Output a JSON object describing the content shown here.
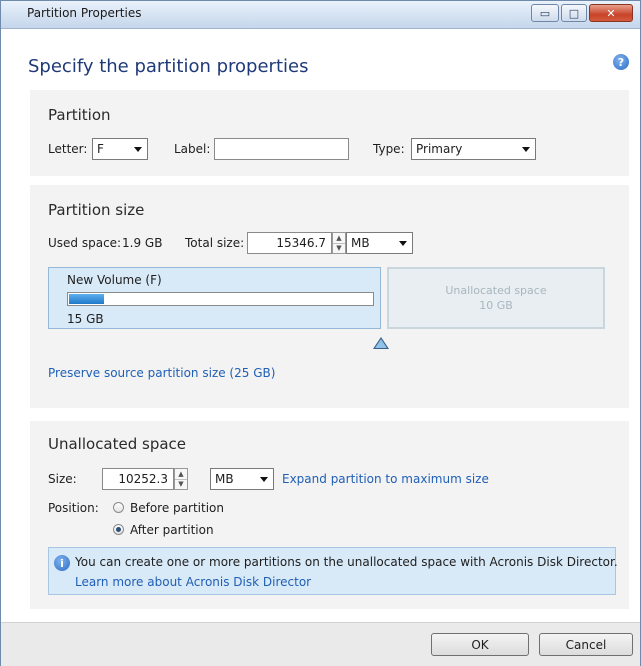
{
  "window": {
    "title": "Partition Properties",
    "minimize_glyph": "▭",
    "maximize_glyph": "□",
    "close_glyph": "✕"
  },
  "heading": "Specify the partition properties",
  "help_icon": "?",
  "partition": {
    "title": "Partition",
    "letter_label": "Letter:",
    "letter_value": "F",
    "label_label": "Label:",
    "label_value": "",
    "type_label": "Type:",
    "type_value": "Primary"
  },
  "partition_size": {
    "title": "Partition size",
    "used_space_label": "Used space:",
    "used_space_value": "1.9 GB",
    "total_size_label": "Total size:",
    "total_size_value": "15346.7",
    "unit": "MB",
    "volume_name": "New Volume (F)",
    "volume_size": "15 GB",
    "volume_used_fraction": 0.12,
    "unallocated_title": "Unallocated space",
    "unallocated_size": "10 GB",
    "preserve_link": "Preserve source partition size (25 GB)"
  },
  "unallocated": {
    "title": "Unallocated space",
    "size_label": "Size:",
    "size_value": "10252.3",
    "unit": "MB",
    "expand_link": "Expand partition to maximum size",
    "position_label": "Position:",
    "before_label": "Before partition",
    "after_label": "After partition",
    "selected": "after"
  },
  "info": {
    "text": "You can create one or more partitions on the unallocated space with Acronis Disk Director.",
    "link": "Learn more about Acronis Disk Director"
  },
  "buttons": {
    "ok": "OK",
    "cancel": "Cancel"
  }
}
